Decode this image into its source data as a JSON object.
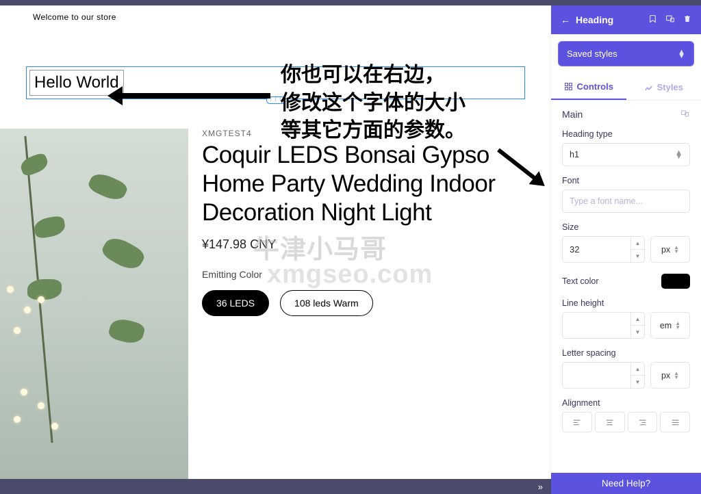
{
  "welcome": "Welcome to our store",
  "selected_text": "Hello World",
  "annotation": {
    "line1": "你也可以在右边，",
    "line2": "修改这个字体的大小",
    "line3": "等其它方面的参数。"
  },
  "watermark": {
    "w1": "牛津小马哥",
    "w2": "xmgseo.com"
  },
  "product": {
    "brand": "XMGTEST4",
    "title": "Coquir LEDS Bonsai Gypso Home Party Wedding Indoor Decoration Night Light",
    "price": "¥147.98 CNY",
    "option_label": "Emitting Color",
    "variants": [
      "36 LEDS",
      "108 leds Warm"
    ]
  },
  "panel": {
    "title": "Heading",
    "saved_styles": "Saved styles",
    "tabs": {
      "controls": "Controls",
      "styles": "Styles"
    },
    "section_main": "Main",
    "labels": {
      "heading_type": "Heading type",
      "font": "Font",
      "size": "Size",
      "text_color": "Text color",
      "line_height": "Line height",
      "letter_spacing": "Letter spacing",
      "alignment": "Alignment"
    },
    "values": {
      "heading_type": "h1",
      "font_placeholder": "Type a font name...",
      "size": "32",
      "size_unit": "px",
      "line_height": "",
      "line_height_unit": "em",
      "letter_spacing": "",
      "letter_spacing_unit": "px",
      "text_color": "#000000"
    },
    "need_help": "Need Help?"
  }
}
